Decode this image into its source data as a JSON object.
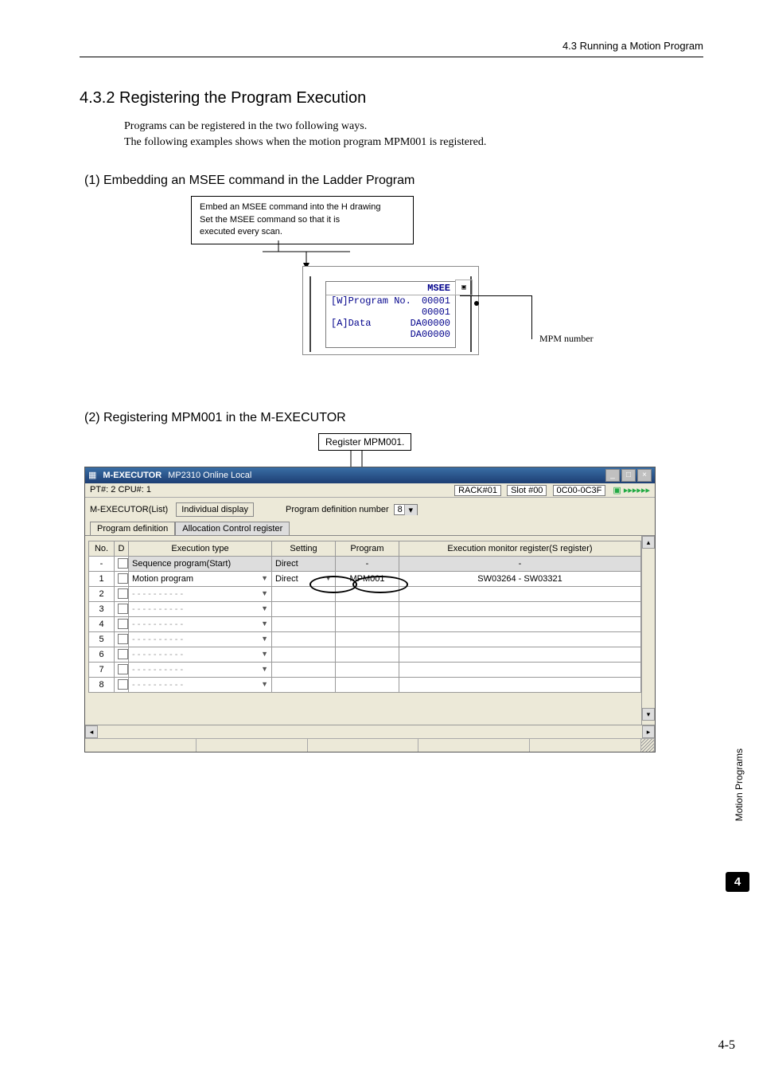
{
  "header": {
    "crumb": "4.3  Running a Motion Program"
  },
  "sec": {
    "num_title": "4.3.2  Registering the Program Execution",
    "intro1": "Programs can be registered in the two following ways.",
    "intro2": "The following examples shows when the motion program MPM001 is registered."
  },
  "sub1": {
    "title": "(1) Embedding an MSEE command in the Ladder Program",
    "box_l1": "Embed an MSEE command into the H drawing",
    "box_l2": "Set the MSEE command so that it is",
    "box_l3": "executed every scan.",
    "ladder": {
      "title": "MSEE",
      "row1a": "[W]Program No.",
      "row1b": "00001",
      "row1b2": "00001",
      "row2a": "[A]Data",
      "row2b": "DA00000",
      "row2b2": "DA00000",
      "label": "MPM number"
    }
  },
  "sub2": {
    "title": "(2) Registering MPM001 in the M-EXECUTOR",
    "callout": "Register MPM001."
  },
  "win": {
    "title_left": "M-EXECUTOR",
    "title_mid": "MP2310   Online Local",
    "ptcpu": "PT#: 2 CPU#: 1",
    "rack": "RACK#01",
    "slot": "Slot #00",
    "addr": "0C00-0C3F",
    "listlbl": "M-EXECUTOR(List)",
    "indbtn": "Individual display",
    "pdnum_lbl": "Program definition number",
    "pdnum_val": "8",
    "tab1": "Program definition",
    "tab2": "Allocation Control register",
    "cols": {
      "no": "No.",
      "d": "D",
      "exec": "Execution type",
      "setting": "Setting",
      "program": "Program",
      "mon": "Execution monitor register(S register)"
    },
    "rows": {
      "dash_no": "-",
      "seq": "Sequence program(Start)",
      "direct": "Direct",
      "dash": "-",
      "r1_no": "1",
      "r1_exec": "Motion program",
      "r1_set": "Direct",
      "r1_prog": "MPM001",
      "r1_mon": "SW03264 - SW03321",
      "r2": "2",
      "r3": "3",
      "r4": "4",
      "r5": "5",
      "r6": "6",
      "r7": "7",
      "r8": "8",
      "blank": "- - - - - - - - - -"
    }
  },
  "side": {
    "tab": "Motion Programs",
    "ch": "4",
    "page": "4-5"
  }
}
